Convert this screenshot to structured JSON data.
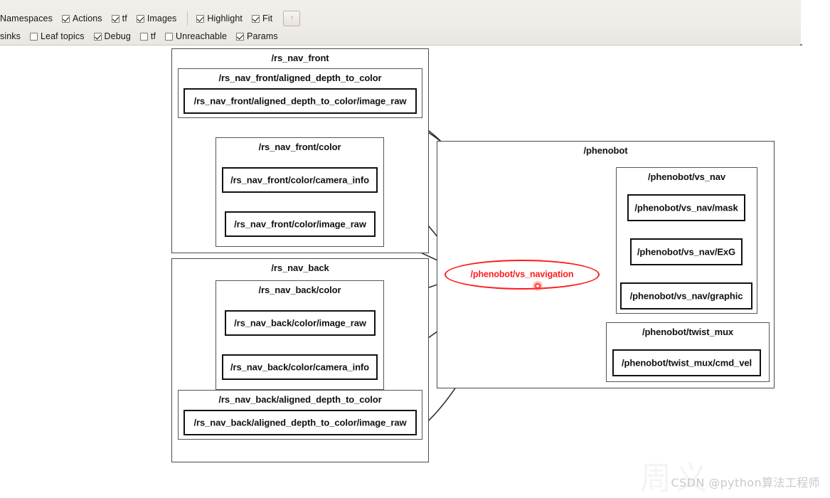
{
  "toolbar": {
    "row1": [
      {
        "label": "Namespaces",
        "type": "text",
        "checked": null,
        "name": "toolbar-label-namespaces"
      },
      {
        "label": "Actions",
        "type": "checkbox",
        "checked": true,
        "name": "checkbox-actions"
      },
      {
        "label": "tf",
        "type": "checkbox",
        "checked": true,
        "name": "checkbox-tf-top"
      },
      {
        "label": "Images",
        "type": "checkbox",
        "checked": true,
        "name": "checkbox-images"
      },
      {
        "label": "Highlight",
        "type": "checkbox",
        "checked": true,
        "name": "checkbox-highlight"
      },
      {
        "label": "Fit",
        "type": "checkbox",
        "checked": true,
        "name": "checkbox-fit"
      }
    ],
    "row2": [
      {
        "label": "sinks",
        "type": "text",
        "checked": null,
        "name": "toolbar-label-sinks"
      },
      {
        "label": "Leaf topics",
        "type": "checkbox",
        "checked": false,
        "name": "checkbox-leaf-topics"
      },
      {
        "label": "Debug",
        "type": "checkbox",
        "checked": true,
        "name": "checkbox-debug"
      },
      {
        "label": "tf",
        "type": "checkbox",
        "checked": false,
        "name": "checkbox-tf-bottom"
      },
      {
        "label": "Unreachable",
        "type": "checkbox",
        "checked": false,
        "name": "checkbox-unreachable"
      },
      {
        "label": "Params",
        "type": "checkbox",
        "checked": true,
        "name": "checkbox-params"
      }
    ],
    "fit_button_glyph": "↑",
    "fit_button_name": "fit-to-window-button"
  },
  "graph": {
    "groups": [
      {
        "id": "rs_nav_front",
        "title": "/rs_nav_front",
        "children": [
          {
            "id": "rs_nav_front_aligned",
            "title": "/rs_nav_front/aligned_depth_to_color",
            "leaves": [
              {
                "id": "front_aligned_image_raw",
                "label": "/rs_nav_front/aligned_depth_to_color/image_raw"
              }
            ]
          },
          {
            "id": "rs_nav_front_color",
            "title": "/rs_nav_front/color",
            "leaves": [
              {
                "id": "front_color_camera_info",
                "label": "/rs_nav_front/color/camera_info"
              },
              {
                "id": "front_color_image_raw",
                "label": "/rs_nav_front/color/image_raw"
              }
            ]
          }
        ]
      },
      {
        "id": "rs_nav_back",
        "title": "/rs_nav_back",
        "children": [
          {
            "id": "rs_nav_back_color",
            "title": "/rs_nav_back/color",
            "leaves": [
              {
                "id": "back_color_image_raw",
                "label": "/rs_nav_back/color/image_raw"
              },
              {
                "id": "back_color_camera_info",
                "label": "/rs_nav_back/color/camera_info"
              }
            ]
          },
          {
            "id": "rs_nav_back_aligned",
            "title": "/rs_nav_back/aligned_depth_to_color",
            "leaves": [
              {
                "id": "back_aligned_image_raw",
                "label": "/rs_nav_back/aligned_depth_to_color/image_raw"
              }
            ]
          }
        ]
      },
      {
        "id": "phenobot",
        "title": "/phenobot",
        "children": [
          {
            "id": "phenobot_vs_nav",
            "title": "/phenobot/vs_nav",
            "leaves": [
              {
                "id": "vs_nav_mask",
                "label": "/phenobot/vs_nav/mask"
              },
              {
                "id": "vs_nav_exg",
                "label": "/phenobot/vs_nav/ExG"
              },
              {
                "id": "vs_nav_graphic",
                "label": "/phenobot/vs_nav/graphic"
              }
            ]
          },
          {
            "id": "phenobot_twist_mux",
            "title": "/phenobot/twist_mux",
            "leaves": [
              {
                "id": "twist_mux_cmd_vel",
                "label": "/phenobot/twist_mux/cmd_vel"
              }
            ]
          }
        ]
      }
    ],
    "selected_node": {
      "id": "vs_navigation",
      "label": "/phenobot/vs_navigation",
      "color": "#ff1a1a",
      "shape": "ellipse"
    }
  },
  "watermarks": {
    "center": "周义",
    "footer": "CSDN @python算法工程师"
  }
}
